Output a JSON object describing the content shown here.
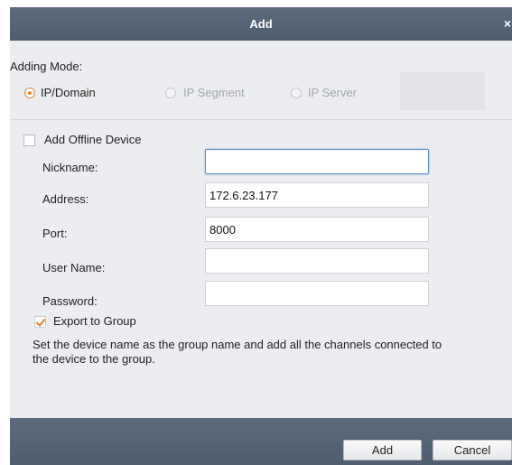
{
  "dialog": {
    "title": "Add",
    "close_glyph": "×"
  },
  "adding_mode": {
    "label": "Adding Mode:",
    "options": [
      {
        "label": "IP/Domain",
        "selected": true,
        "enabled": true
      },
      {
        "label": "IP Segment",
        "selected": false,
        "enabled": false
      },
      {
        "label": "IP Server",
        "selected": false,
        "enabled": false
      }
    ]
  },
  "offline": {
    "label": "Add Offline Device",
    "checked": false
  },
  "form": {
    "nickname": {
      "label": "Nickname:",
      "value": ""
    },
    "address": {
      "label": "Address:",
      "value": "172.6.23.177"
    },
    "port": {
      "label": "Port:",
      "value": "8000"
    },
    "username": {
      "label": "User Name:",
      "value": ""
    },
    "password": {
      "label": "Password:",
      "value": ""
    }
  },
  "export": {
    "label": "Export to Group",
    "checked": true,
    "description": "Set the device name as the group name and add all the channels connected to the device to the group."
  },
  "buttons": {
    "add": "Add",
    "cancel": "Cancel"
  },
  "colors": {
    "titlebar": "#56647a",
    "accent": "#e8892a",
    "focus": "#5b8cc8"
  }
}
